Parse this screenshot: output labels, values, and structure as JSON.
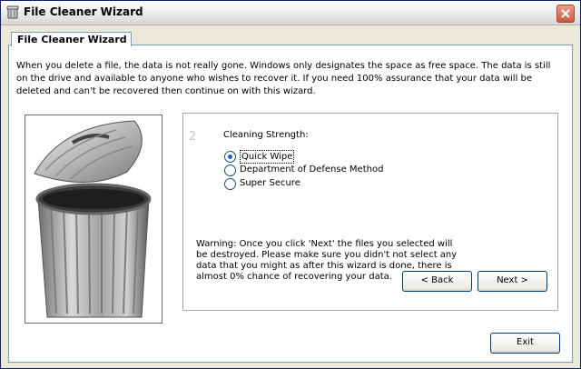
{
  "window": {
    "title": "File Cleaner Wizard"
  },
  "tab": {
    "label": "File Cleaner Wizard"
  },
  "intro": "When you delete a file, the data is not really gone. Windows only designates the space as free space. The data is still on the drive and available to anyone who wishes to recover it. If you need 100% assurance that your data will be deleted and can't be recovered then continue on with this wizard.",
  "step": {
    "number": "2",
    "label": "Cleaning Strength:"
  },
  "options": [
    {
      "label": "Quick Wipe",
      "selected": true
    },
    {
      "label": "Department of Defense Method",
      "selected": false
    },
    {
      "label": "Super Secure",
      "selected": false
    }
  ],
  "warning": "Warning: Once you click 'Next' the files you selected will be destroyed. Please make sure you didn't not select any data that you might as after this wizard is done, there is almost 0% chance of recovering your data.",
  "buttons": {
    "back": "< Back",
    "next": "Next >",
    "exit": "Exit"
  },
  "colors": {
    "accent": "#215dc6",
    "close": "#c85a40"
  }
}
